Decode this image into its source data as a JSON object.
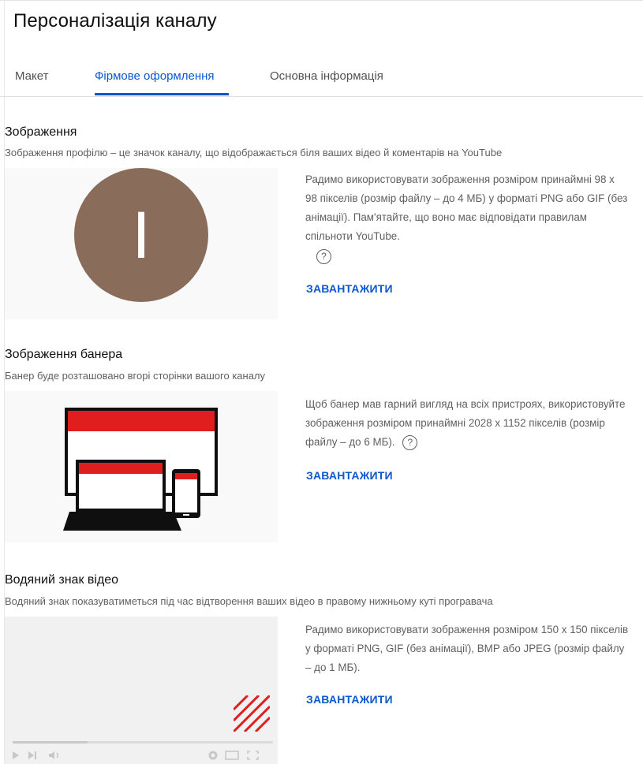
{
  "page": {
    "title": "Персоналізація каналу"
  },
  "tabs": [
    {
      "label": "Макет"
    },
    {
      "label": "Фірмове оформлення"
    },
    {
      "label": "Основна інформація"
    }
  ],
  "picture": {
    "title": "Зображення",
    "description": "Зображення профілю – це значок каналу, що відображається біля ваших відео й коментарів на YouTube",
    "avatar_letter": "I",
    "avatar_color": "#8a6c5b",
    "info_text": "Радимо використовувати зображення розміром принаймні 98 x 98 пікселів (розмір файлу – до 4 МБ) у форматі PNG або GIF (без анімації). Пам'ятайте, що воно має відповідати правилам спільноти YouTube.",
    "help_symbol": "?",
    "upload_label": "ЗАВАНТАЖИТИ"
  },
  "banner": {
    "title": "Зображення банера",
    "description": "Банер буде розташовано вгорі сторінки вашого каналу",
    "info_text": "Щоб банер мав гарний вигляд на всіх пристроях, використовуйте зображення розміром принаймні 2028 x 1152 пікселів (розмір файлу – до 6 МБ).",
    "help_symbol": "?",
    "upload_label": "ЗАВАНТАЖИТИ",
    "accent_color": "#e01e1e"
  },
  "watermark": {
    "title": "Водяний знак відео",
    "description": "Водяний знак показуватиметься під час відтворення ваших відео в правому нижньому куті програвача",
    "info_text": "Радимо використовувати зображення розміром 150 x 150 пікселів у форматі PNG, GIF (без анімації), BMP або JPEG (розмір файлу – до 1 МБ).",
    "upload_label": "ЗАВАНТАЖИТИ"
  },
  "colors": {
    "accent": "#0b57d0",
    "text": "#0f0f0f",
    "secondary": "#606060"
  }
}
